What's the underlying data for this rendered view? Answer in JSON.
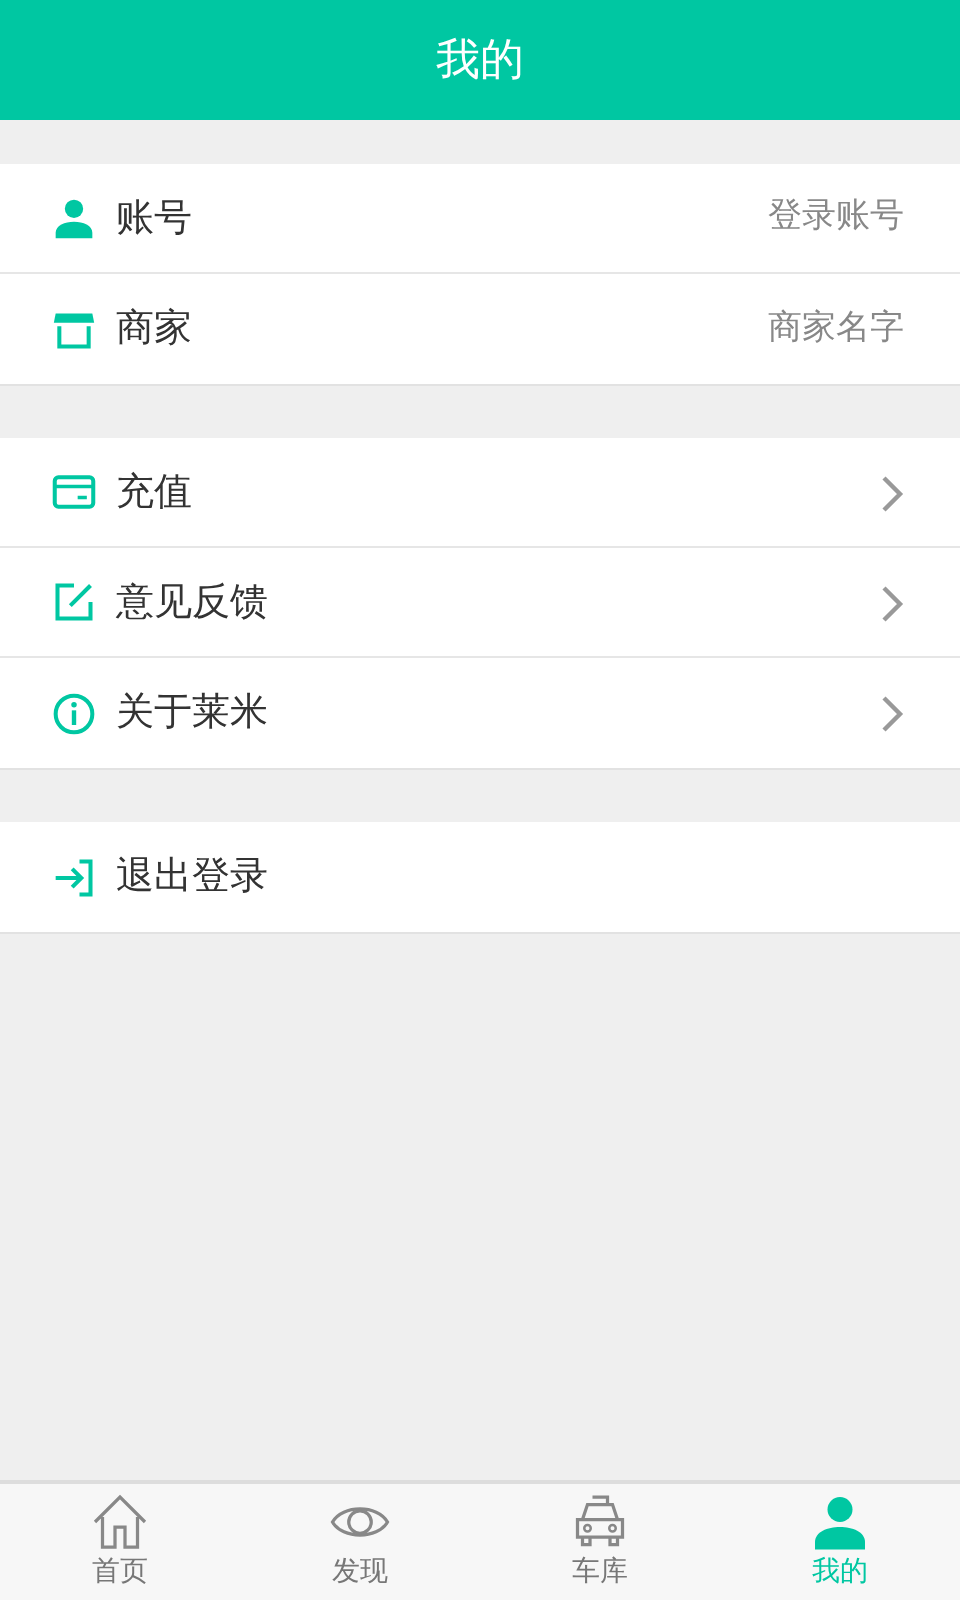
{
  "header": {
    "title": "我的"
  },
  "groups": [
    {
      "items": [
        {
          "kind": "value",
          "label": "账号",
          "value": "登录账号"
        },
        {
          "kind": "value",
          "label": "商家",
          "value": "商家名字"
        }
      ]
    },
    {
      "items": [
        {
          "kind": "link",
          "label": "充值"
        },
        {
          "kind": "link",
          "label": "意见反馈"
        },
        {
          "kind": "link",
          "label": "关于莱米"
        }
      ]
    },
    {
      "items": [
        {
          "kind": "plain",
          "label": "退出登录"
        }
      ]
    }
  ],
  "tabbar": [
    {
      "label": "首页",
      "selected": false
    },
    {
      "label": "发现",
      "selected": false
    },
    {
      "label": "车库",
      "selected": false
    },
    {
      "label": "我的",
      "selected": true
    }
  ]
}
